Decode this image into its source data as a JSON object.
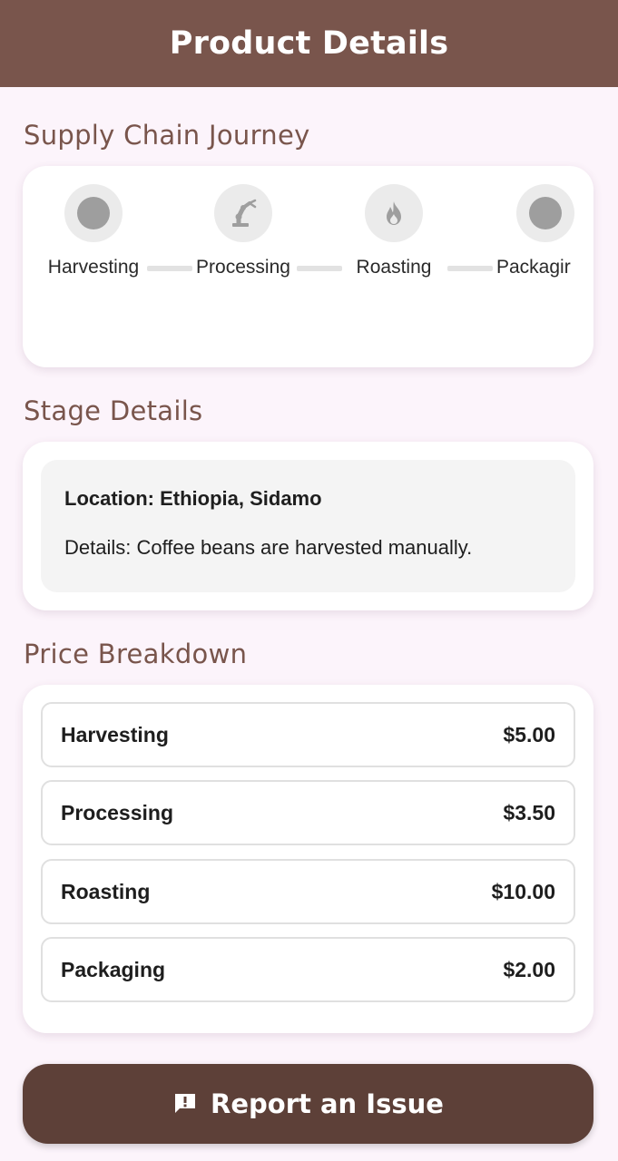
{
  "app_bar": {
    "title": "Product Details",
    "color": "#79554c"
  },
  "journey": {
    "title": "Supply Chain Journey",
    "stages": [
      {
        "label": "Harvesting",
        "icon": "circle-dot-icon"
      },
      {
        "label": "Processing",
        "icon": "robot-arm-icon"
      },
      {
        "label": "Roasting",
        "icon": "flame-icon"
      },
      {
        "label": "Packagir",
        "icon": "circle-dot-icon"
      }
    ]
  },
  "stage_details": {
    "title": "Stage Details",
    "location": "Location: Ethiopia, Sidamo",
    "details": "Details: Coffee beans are harvested manually."
  },
  "price_breakdown": {
    "title": "Price Breakdown",
    "items": [
      {
        "name": "Harvesting",
        "price": "$5.00"
      },
      {
        "name": "Processing",
        "price": "$3.50"
      },
      {
        "name": "Roasting",
        "price": "$10.00"
      },
      {
        "name": "Packaging",
        "price": "$2.00"
      }
    ]
  },
  "report_button": {
    "label": "Report an Issue",
    "icon": "report-icon",
    "color": "#5d4038"
  }
}
